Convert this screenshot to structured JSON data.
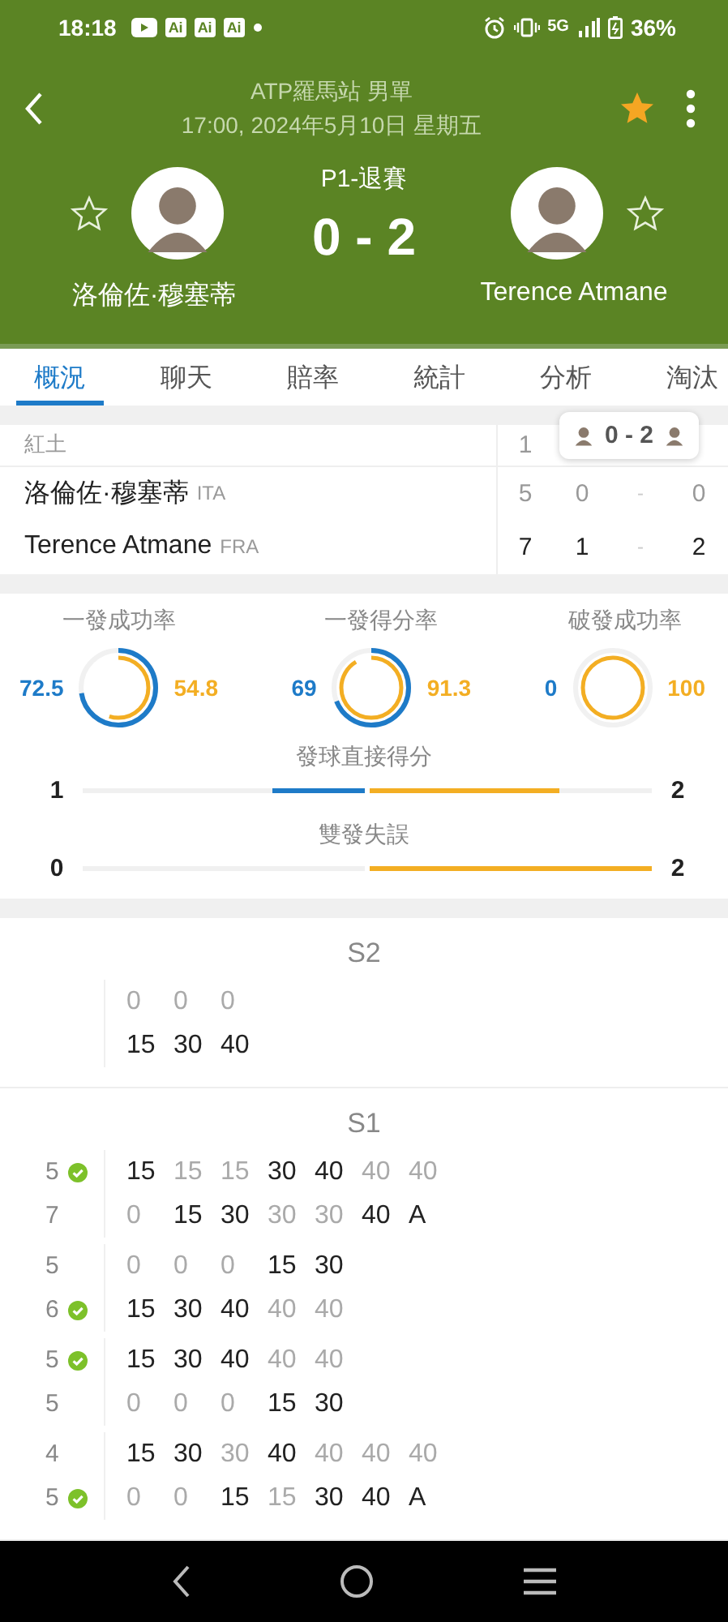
{
  "status_bar": {
    "time": "18:18",
    "app_labels": [
      "Ai",
      "Ai",
      "Ai"
    ],
    "network": "5G",
    "battery": "36%"
  },
  "header": {
    "title": "ATP羅馬站 男單",
    "subtitle": "17:00, 2024年5月10日 星期五",
    "favorite": true,
    "match_status": "P1-退賽",
    "score": "0 - 2",
    "players": [
      {
        "name": "洛倫佐·穆塞蒂",
        "favorite": false
      },
      {
        "name": "Terence Atmane",
        "favorite": false
      }
    ]
  },
  "tabs": [
    {
      "label": "概況",
      "selected": true
    },
    {
      "label": "聊天",
      "selected": false
    },
    {
      "label": "賠率",
      "selected": false
    },
    {
      "label": "統計",
      "selected": false
    },
    {
      "label": "分析",
      "selected": false
    },
    {
      "label": "淘汰",
      "selected": false
    }
  ],
  "score_table": {
    "surface": "紅土",
    "set_header": "1",
    "badge_score": "0 - 2",
    "rows": [
      {
        "name": "洛倫佐·穆塞蒂",
        "country": "ITA",
        "cells": [
          "5",
          "0",
          "-",
          "0"
        ]
      },
      {
        "name": "Terence Atmane",
        "country": "FRA",
        "cells": [
          "7",
          "1",
          "-",
          "2"
        ]
      }
    ]
  },
  "rings": [
    {
      "label": "一發成功率",
      "left": {
        "text": "72.5",
        "level": 0.725
      },
      "right": {
        "text": "54.8",
        "level": 0.548
      }
    },
    {
      "label": "一發得分率",
      "left": {
        "text": "69",
        "level": 0.69
      },
      "right": {
        "text": "91.3",
        "level": 0.913
      }
    },
    {
      "label": "破發成功率",
      "left": {
        "text": "0",
        "level": 0
      },
      "right": {
        "text": "100",
        "level": 1
      }
    }
  ],
  "bars": [
    {
      "label": "發球直接得分",
      "left": {
        "text": "1",
        "level": 0.33
      },
      "right": {
        "text": "2",
        "level": 0.67
      }
    },
    {
      "label": "雙發失誤",
      "left": {
        "text": "0",
        "level": 0
      },
      "right": {
        "text": "2",
        "level": 1
      }
    }
  ],
  "sets": [
    {
      "title": "S2",
      "games": [
        {
          "rows": [
            {
              "points": [
                {
                  "t": "0",
                  "on": false
                },
                {
                  "t": "0",
                  "on": false
                },
                {
                  "t": "0",
                  "on": false
                }
              ]
            },
            {
              "points": [
                {
                  "t": "15",
                  "on": true
                },
                {
                  "t": "30",
                  "on": true
                },
                {
                  "t": "40",
                  "on": true
                }
              ]
            }
          ]
        }
      ]
    },
    {
      "title": "S1",
      "games": [
        {
          "rows": [
            {
              "score": "5",
              "winner": true,
              "points": [
                {
                  "t": "15",
                  "on": true
                },
                {
                  "t": "15",
                  "on": false
                },
                {
                  "t": "15",
                  "on": false
                },
                {
                  "t": "30",
                  "on": true
                },
                {
                  "t": "40",
                  "on": true
                },
                {
                  "t": "40",
                  "on": false
                },
                {
                  "t": "40",
                  "on": false
                }
              ]
            },
            {
              "score": "7",
              "winner": false,
              "points": [
                {
                  "t": "0",
                  "on": false
                },
                {
                  "t": "15",
                  "on": true
                },
                {
                  "t": "30",
                  "on": true
                },
                {
                  "t": "30",
                  "on": false
                },
                {
                  "t": "30",
                  "on": false
                },
                {
                  "t": "40",
                  "on": true
                },
                {
                  "t": "A",
                  "on": true
                }
              ]
            }
          ]
        },
        {
          "rows": [
            {
              "score": "5",
              "winner": false,
              "points": [
                {
                  "t": "0",
                  "on": false
                },
                {
                  "t": "0",
                  "on": false
                },
                {
                  "t": "0",
                  "on": false
                },
                {
                  "t": "15",
                  "on": true
                },
                {
                  "t": "30",
                  "on": true
                }
              ]
            },
            {
              "score": "6",
              "winner": true,
              "points": [
                {
                  "t": "15",
                  "on": true
                },
                {
                  "t": "30",
                  "on": true
                },
                {
                  "t": "40",
                  "on": true
                },
                {
                  "t": "40",
                  "on": false
                },
                {
                  "t": "40",
                  "on": false
                }
              ]
            }
          ]
        },
        {
          "rows": [
            {
              "score": "5",
              "winner": true,
              "points": [
                {
                  "t": "15",
                  "on": true
                },
                {
                  "t": "30",
                  "on": true
                },
                {
                  "t": "40",
                  "on": true
                },
                {
                  "t": "40",
                  "on": false
                },
                {
                  "t": "40",
                  "on": false
                }
              ]
            },
            {
              "score": "5",
              "winner": false,
              "points": [
                {
                  "t": "0",
                  "on": false
                },
                {
                  "t": "0",
                  "on": false
                },
                {
                  "t": "0",
                  "on": false
                },
                {
                  "t": "15",
                  "on": true
                },
                {
                  "t": "30",
                  "on": true
                }
              ]
            }
          ]
        },
        {
          "rows": [
            {
              "score": "4",
              "winner": false,
              "points": [
                {
                  "t": "15",
                  "on": true
                },
                {
                  "t": "30",
                  "on": true
                },
                {
                  "t": "30",
                  "on": false
                },
                {
                  "t": "40",
                  "on": true
                },
                {
                  "t": "40",
                  "on": false
                },
                {
                  "t": "40",
                  "on": false
                },
                {
                  "t": "40",
                  "on": false
                }
              ]
            },
            {
              "score": "5",
              "winner": true,
              "points": [
                {
                  "t": "0",
                  "on": false
                },
                {
                  "t": "0",
                  "on": false
                },
                {
                  "t": "15",
                  "on": true
                },
                {
                  "t": "15",
                  "on": false
                },
                {
                  "t": "30",
                  "on": true
                },
                {
                  "t": "40",
                  "on": true
                },
                {
                  "t": "A",
                  "on": true
                }
              ]
            }
          ]
        }
      ]
    }
  ]
}
